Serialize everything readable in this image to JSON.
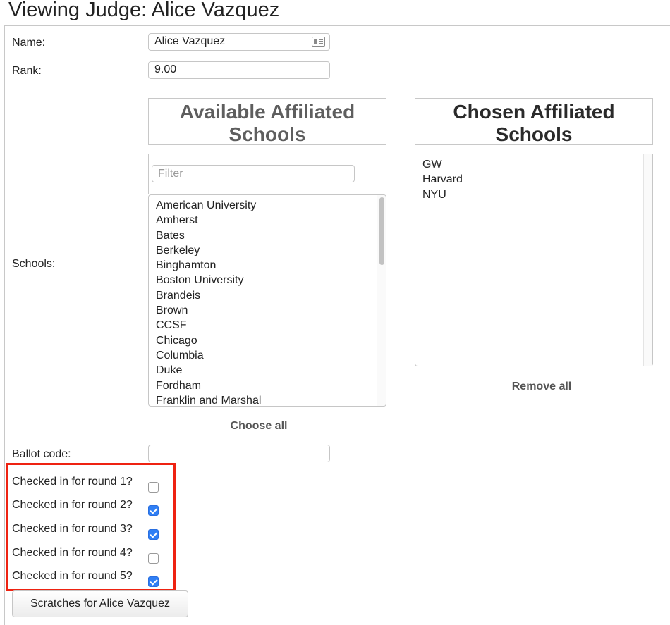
{
  "page_title": "Viewing Judge: Alice Vazquez",
  "form": {
    "name_label": "Name:",
    "name_value": "Alice Vazquez",
    "rank_label": "Rank:",
    "rank_value": "9.00",
    "schools_label": "Schools:",
    "ballot_code_label": "Ballot code:",
    "ballot_code_value": ""
  },
  "schools": {
    "available_header": "Available Affiliated Schools",
    "chosen_header": "Chosen Affiliated Schools",
    "filter_placeholder": "Filter",
    "available": [
      "American University",
      "Amherst",
      "Bates",
      "Berkeley",
      "Binghamton",
      "Boston University",
      "Brandeis",
      "Brown",
      "CCSF",
      "Chicago",
      "Columbia",
      "Duke",
      "Fordham",
      "Franklin and Marshal"
    ],
    "chosen": [
      "GW",
      "Harvard",
      "NYU"
    ],
    "choose_all_label": "Choose all",
    "remove_all_label": "Remove all"
  },
  "checkins": [
    {
      "label": "Checked in for round 1?",
      "checked": false
    },
    {
      "label": "Checked in for round 2?",
      "checked": true
    },
    {
      "label": "Checked in for round 3?",
      "checked": true
    },
    {
      "label": "Checked in for round 4?",
      "checked": false
    },
    {
      "label": "Checked in for round 5?",
      "checked": true
    }
  ],
  "scratches_button": "Scratches for Alice Vazquez",
  "colors": {
    "highlight": "#ee2211",
    "checkbox_checked": "#2f7ff5"
  }
}
